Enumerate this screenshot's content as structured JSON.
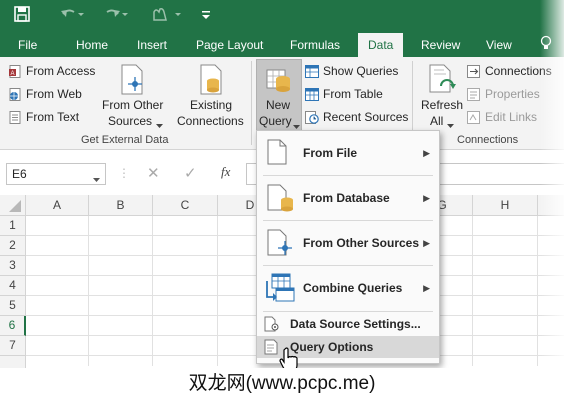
{
  "qat": {
    "save_icon": "save-icon",
    "undo_icon": "undo-icon",
    "redo_icon": "redo-icon",
    "touch_icon": "touch-mode-icon",
    "customize_icon": "customize-icon"
  },
  "tabs": [
    {
      "label": "File"
    },
    {
      "label": "Home"
    },
    {
      "label": "Insert"
    },
    {
      "label": "Page Layout"
    },
    {
      "label": "Formulas"
    },
    {
      "label": "Data"
    },
    {
      "label": "Review"
    },
    {
      "label": "View"
    }
  ],
  "ribbon": {
    "get_external": {
      "from_access": "From Access",
      "from_web": "From Web",
      "from_text": "From Text",
      "from_other_1": "From Other",
      "from_other_2": "Sources",
      "existing_1": "Existing",
      "existing_2": "Connections",
      "group_label": "Get External Data"
    },
    "new_query_1": "New",
    "new_query_2": "Query",
    "show_queries": "Show Queries",
    "from_table": "From Table",
    "recent_sources": "Recent Sources",
    "refresh_1": "Refresh",
    "refresh_2": "All",
    "connections": "Connections",
    "properties": "Properties",
    "edit_links": "Edit Links",
    "connections_group": "Connections"
  },
  "formula_bar": {
    "name_box": "E6"
  },
  "columns": [
    "A",
    "B",
    "C",
    "D",
    "G",
    "H"
  ],
  "rows": [
    "1",
    "2",
    "3",
    "4",
    "5",
    "6",
    "7"
  ],
  "menu": {
    "from_file": "From File",
    "from_database": "From Database",
    "from_other": "From Other Sources",
    "combine": "Combine Queries",
    "data_source_settings": "Data Source Settings...",
    "query_options": "Query Options"
  },
  "caption": "双龙网(www.pcpc.me)",
  "colors": {
    "excel_green": "#217346",
    "ribbon_bg": "#f3f3f3"
  }
}
